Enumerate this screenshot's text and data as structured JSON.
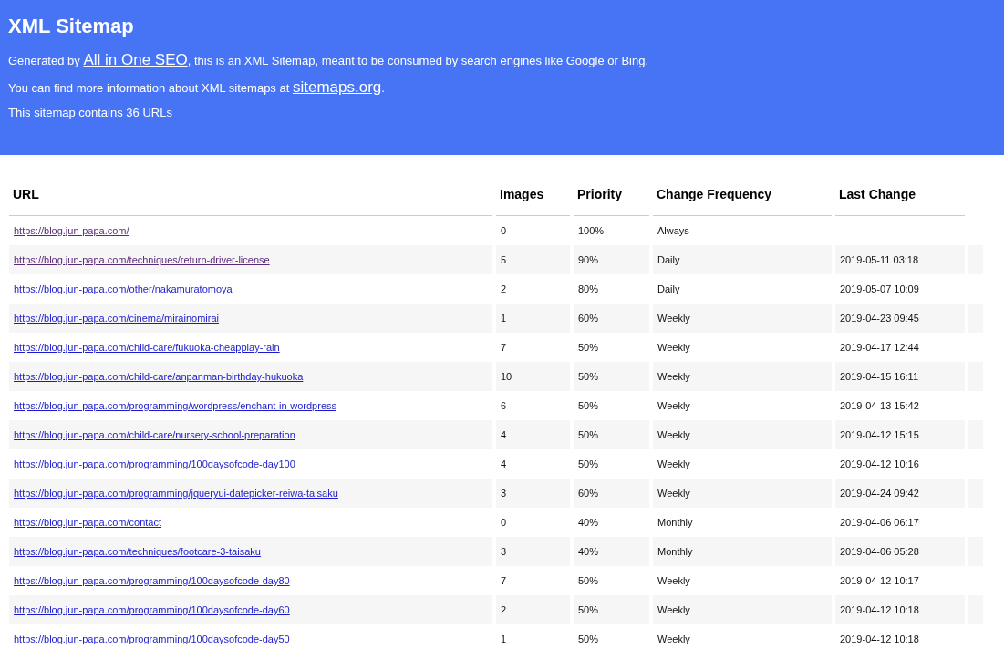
{
  "header": {
    "title": "XML Sitemap",
    "generated": {
      "before": "Generated by ",
      "link": "All in One SEO",
      "after": ", this is an XML Sitemap, meant to be consumed by search engines like Google or Bing."
    },
    "info": {
      "before": "You can find more information about XML sitemaps at ",
      "link": "sitemaps.org",
      "after": "."
    },
    "count": "This sitemap contains 36 URLs"
  },
  "table": {
    "columns": [
      "URL",
      "Images",
      "Priority",
      "Change Frequency",
      "Last Change"
    ],
    "rows": [
      {
        "url": "https://blog.jun-papa.com/",
        "visited": true,
        "images": "0",
        "priority": "100%",
        "frequency": "Always"
      },
      {
        "url": "https://blog.jun-papa.com/techniques/return-driver-license",
        "visited": true,
        "images": "5",
        "priority": "90%",
        "frequency": "Daily",
        "last_change": "2019-05-11 03:18"
      },
      {
        "url": "https://blog.jun-papa.com/other/nakamuratomoya",
        "visited": false,
        "images": "2",
        "priority": "80%",
        "frequency": "Daily",
        "last_change": "2019-05-07 10:09"
      },
      {
        "url": "https://blog.jun-papa.com/cinema/mirainomirai",
        "visited": false,
        "images": "1",
        "priority": "60%",
        "frequency": "Weekly",
        "last_change": "2019-04-23 09:45"
      },
      {
        "url": "https://blog.jun-papa.com/child-care/fukuoka-cheapplay-rain",
        "visited": false,
        "images": "7",
        "priority": "50%",
        "frequency": "Weekly",
        "last_change": "2019-04-17 12:44"
      },
      {
        "url": "https://blog.jun-papa.com/child-care/anpanman-birthday-hukuoka",
        "visited": false,
        "images": "10",
        "priority": "50%",
        "frequency": "Weekly",
        "last_change": "2019-04-15 16:11"
      },
      {
        "url": "https://blog.jun-papa.com/programming/wordpress/enchant-in-wordpress",
        "visited": false,
        "images": "6",
        "priority": "50%",
        "frequency": "Weekly",
        "last_change": "2019-04-13 15:42"
      },
      {
        "url": "https://blog.jun-papa.com/child-care/nursery-school-preparation",
        "visited": false,
        "images": "4",
        "priority": "50%",
        "frequency": "Weekly",
        "last_change": "2019-04-12 15:15"
      },
      {
        "url": "https://blog.jun-papa.com/programming/100daysofcode-day100",
        "visited": false,
        "images": "4",
        "priority": "50%",
        "frequency": "Weekly",
        "last_change": "2019-04-12 10:16"
      },
      {
        "url": "https://blog.jun-papa.com/programming/jqueryui-datepicker-reiwa-taisaku",
        "visited": false,
        "images": "3",
        "priority": "60%",
        "frequency": "Weekly",
        "last_change": "2019-04-24 09:42"
      },
      {
        "url": "https://blog.jun-papa.com/contact",
        "visited": false,
        "images": "0",
        "priority": "40%",
        "frequency": "Monthly",
        "last_change": "2019-04-06 06:17"
      },
      {
        "url": "https://blog.jun-papa.com/techniques/footcare-3-taisaku",
        "visited": false,
        "images": "3",
        "priority": "40%",
        "frequency": "Monthly",
        "last_change": "2019-04-06 05:28"
      },
      {
        "url": "https://blog.jun-papa.com/programming/100daysofcode-day80",
        "visited": false,
        "images": "7",
        "priority": "50%",
        "frequency": "Weekly",
        "last_change": "2019-04-12 10:17"
      },
      {
        "url": "https://blog.jun-papa.com/programming/100daysofcode-day60",
        "visited": false,
        "images": "2",
        "priority": "50%",
        "frequency": "Weekly",
        "last_change": "2019-04-12 10:18"
      },
      {
        "url": "https://blog.jun-papa.com/programming/100daysofcode-day50",
        "visited": false,
        "images": "1",
        "priority": "50%",
        "frequency": "Weekly",
        "last_change": "2019-04-12 10:18"
      }
    ]
  }
}
